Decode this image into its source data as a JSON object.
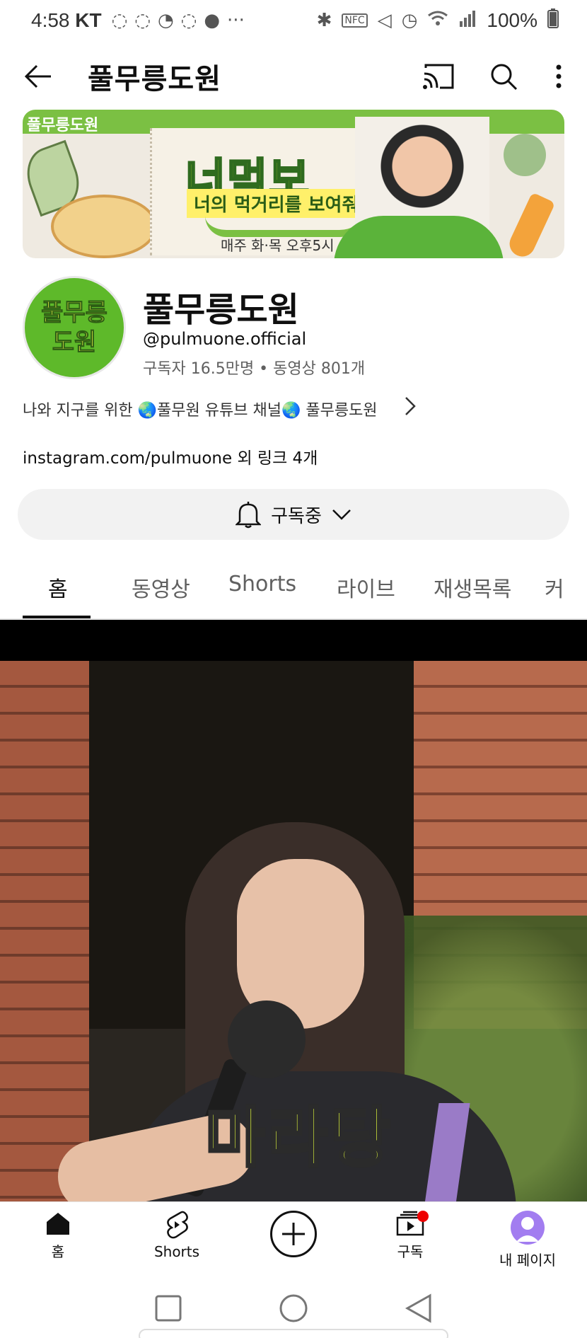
{
  "status_bar": {
    "time": "4:58",
    "carrier": "KT",
    "battery": "100%"
  },
  "header": {
    "title": "풀무릉도원",
    "back_icon": "back-arrow-icon",
    "cast_icon": "cast-icon",
    "search_icon": "search-icon",
    "more_icon": "more-vert-icon"
  },
  "banner": {
    "corner_tag": "풀무릉도원",
    "logo_text": "너먹보",
    "subtitle": "너의 먹거리를 보여줘",
    "schedule": "매주 화·목 오후5시"
  },
  "channel": {
    "avatar_line1": "풀무릉",
    "avatar_line2": "도원",
    "name": "풀무릉도원",
    "handle": "@pulmuone.official",
    "stats": "구독자 16.5만명 • 동영상 801개",
    "description": "나와 지구를 위한 🌏풀무원 유튜브 채널🌏 풀무릉도원",
    "link": "instagram.com/pulmuone 외 링크 4개"
  },
  "subscribe": {
    "label": "구독중"
  },
  "tabs": [
    {
      "label": "홈",
      "active": true
    },
    {
      "label": "동영상",
      "active": false
    },
    {
      "label": "Shorts",
      "active": false
    },
    {
      "label": "라이브",
      "active": false
    },
    {
      "label": "재생목록",
      "active": false
    },
    {
      "label": "커",
      "active": false
    }
  ],
  "video": {
    "caption": "마라탕"
  },
  "bottom_nav": {
    "home": "홈",
    "shorts": "Shorts",
    "subscriptions": "구독",
    "you": "내 페이지"
  },
  "colors": {
    "accent_red": "#ff0000",
    "brand_green": "#5eb92a"
  }
}
